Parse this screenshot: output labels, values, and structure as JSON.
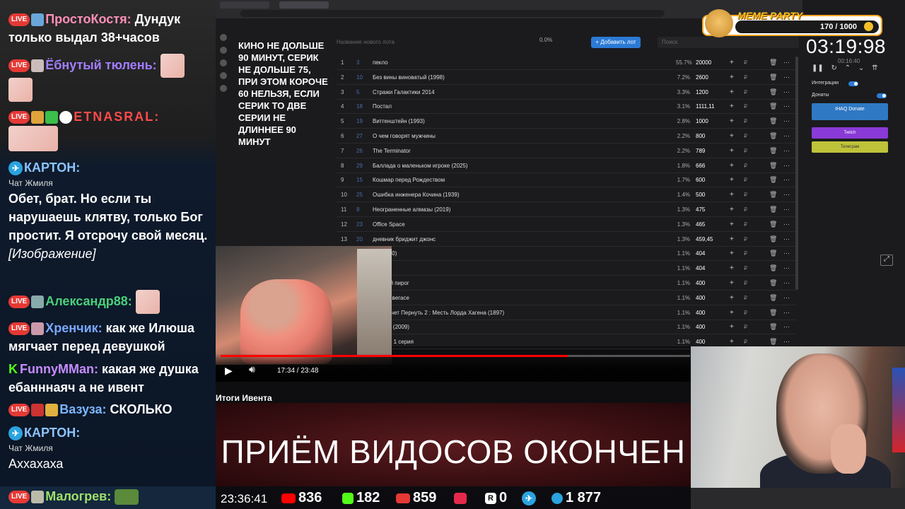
{
  "chat": {
    "messages": [
      {
        "user": "ПростоКостя:",
        "user_color": "#ff8fb7",
        "text": "Дундук только выдал 38+часов"
      },
      {
        "user": "Ёбнутый тюлень:",
        "user_color": "#a27dff",
        "text": ""
      },
      {
        "user": "ЕTNASRAL:",
        "user_color": "#ff4a4a",
        "text": ""
      },
      {
        "user": "КАРТОН:",
        "user_color": "#8cc4ff",
        "sub": "Чат Жмиля",
        "text": "Обет, брат. Но если ты нарушаешь клятву, только Бог простит. Я отсрочу свой месяц.",
        "extra": "[Изображение]"
      },
      {
        "user": "Александр88:",
        "user_color": "#4ad07a",
        "text": ""
      },
      {
        "user": "Хренчик:",
        "user_color": "#79a8ff",
        "text": "как же Илюша мягчает перед девушкой"
      },
      {
        "user": "FunnyMMan:",
        "user_color": "#c58cff",
        "text": "какая же душка ебанннаяч а не ивент"
      },
      {
        "user": "Вазуза:",
        "user_color": "#7ab6ff",
        "text": "СКОЛЬКО"
      },
      {
        "user": "КАРТОН:",
        "user_color": "#8cc4ff",
        "sub": "Чат Жмиля",
        "text": "Аххахаха"
      },
      {
        "user": "Малогрев:",
        "user_color": "#9fe06a",
        "text": ""
      }
    ],
    "live_label": "LIVE"
  },
  "screen": {
    "rules_text": "КИНО НЕ ДОЛЬШЕ 90 МИНУТ, СЕРИК НЕ ДОЛЬШЕ 75, ПРИ ЭТОМ КОРОЧЕ 60 НЕЛЬЗЯ, ЕСЛИ СЕРИК ТО ДВЕ СЕРИИ НЕ ДЛИННЕЕ 90 МИНУТ",
    "search_placeholder": "Название нового лота",
    "percent": "0.0%",
    "add_button": "+ Добавить лот",
    "search2_placeholder": "Поиск",
    "lots": [
      {
        "n": "1",
        "id": "3",
        "title": "пекло",
        "pct": "55.7%",
        "amount": "20000"
      },
      {
        "n": "2",
        "id": "10",
        "title": "Без вины виноватый (1998)",
        "pct": "7.2%",
        "amount": "2600"
      },
      {
        "n": "3",
        "id": "5",
        "title": "Стражи Галактики 2014",
        "pct": "3.3%",
        "amount": "1200"
      },
      {
        "n": "4",
        "id": "18",
        "title": "Постал",
        "pct": "3.1%",
        "amount": "1111,11"
      },
      {
        "n": "5",
        "id": "19",
        "title": "Витгенштейн (1993)",
        "pct": "2.8%",
        "amount": "1000"
      },
      {
        "n": "6",
        "id": "27",
        "title": "О чем говорят мужчины",
        "pct": "2.2%",
        "amount": "800"
      },
      {
        "n": "7",
        "id": "26",
        "title": "The Terminator",
        "pct": "2.2%",
        "amount": "789"
      },
      {
        "n": "8",
        "id": "29",
        "title": "Баллада о маленьком игроке (2025)",
        "pct": "1.8%",
        "amount": "666"
      },
      {
        "n": "9",
        "id": "15",
        "title": "Кошмар перед Рождеством",
        "pct": "1.7%",
        "amount": "600"
      },
      {
        "n": "10",
        "id": "25",
        "title": "Ошибка инженера Кочина (1939)",
        "pct": "1.4%",
        "amount": "500"
      },
      {
        "n": "11",
        "id": "8",
        "title": "Неограненные алмазы (2019)",
        "pct": "1.3%",
        "amount": "475"
      },
      {
        "n": "12",
        "id": "23",
        "title": "Office Space",
        "pct": "1.3%",
        "amount": "465"
      },
      {
        "n": "13",
        "id": "20",
        "title": "дневник бриджит джонс",
        "pct": "1.3%",
        "amount": "459,45"
      },
      {
        "n": "",
        "id": "",
        "title": "rip (2000)",
        "pct": "1.1%",
        "amount": "404"
      },
      {
        "n": "",
        "id": "",
        "title": "енция",
        "pct": "1.1%",
        "amount": "404"
      },
      {
        "n": "",
        "id": "",
        "title": "канский пирог",
        "pct": "1.1%",
        "amount": "400"
      },
      {
        "n": "",
        "id": "",
        "title": "щник в вегасе",
        "pct": "1.1%",
        "amount": "400"
      },
      {
        "n": "",
        "id": "",
        "title": "Фум хочет Пернуть 2 : Месть Лорда Хагена (1897)",
        "pct": "1.1%",
        "amount": "400"
      },
      {
        "n": "",
        "id": "",
        "title": "umpers (2009)",
        "pct": "1.1%",
        "amount": "400"
      },
      {
        "n": "",
        "id": "",
        "title": "2 сезон 1 серия",
        "pct": "1.1%",
        "amount": "400"
      }
    ],
    "timer": "03:19:98",
    "timer_sub": "00:16:40",
    "integrations_label": "Интеграции",
    "donats_label": "Донаты",
    "donat_button": "IHAQ Donate",
    "twitch_button": "Twitch",
    "tg_button": "Телеграм"
  },
  "meme": {
    "title": "MEME PARTY",
    "count": "170 / 1000"
  },
  "video": {
    "time": "17:34 / 23:48",
    "title": "Итоги Ивента",
    "progress": 0.74
  },
  "banner": {
    "text": "ПРИЁМ ВИДОСОВ ОКОНЧЕН"
  },
  "bottom": {
    "clock": "23:36:41",
    "youtube": "836",
    "kick": "182",
    "live": "859",
    "vk": "0",
    "rutube": "0",
    "telegram_viewers": "1 877"
  },
  "colors": {
    "accent_red": "#e53935",
    "kick_green": "#53fc18",
    "tg_blue": "#2aa3df"
  }
}
